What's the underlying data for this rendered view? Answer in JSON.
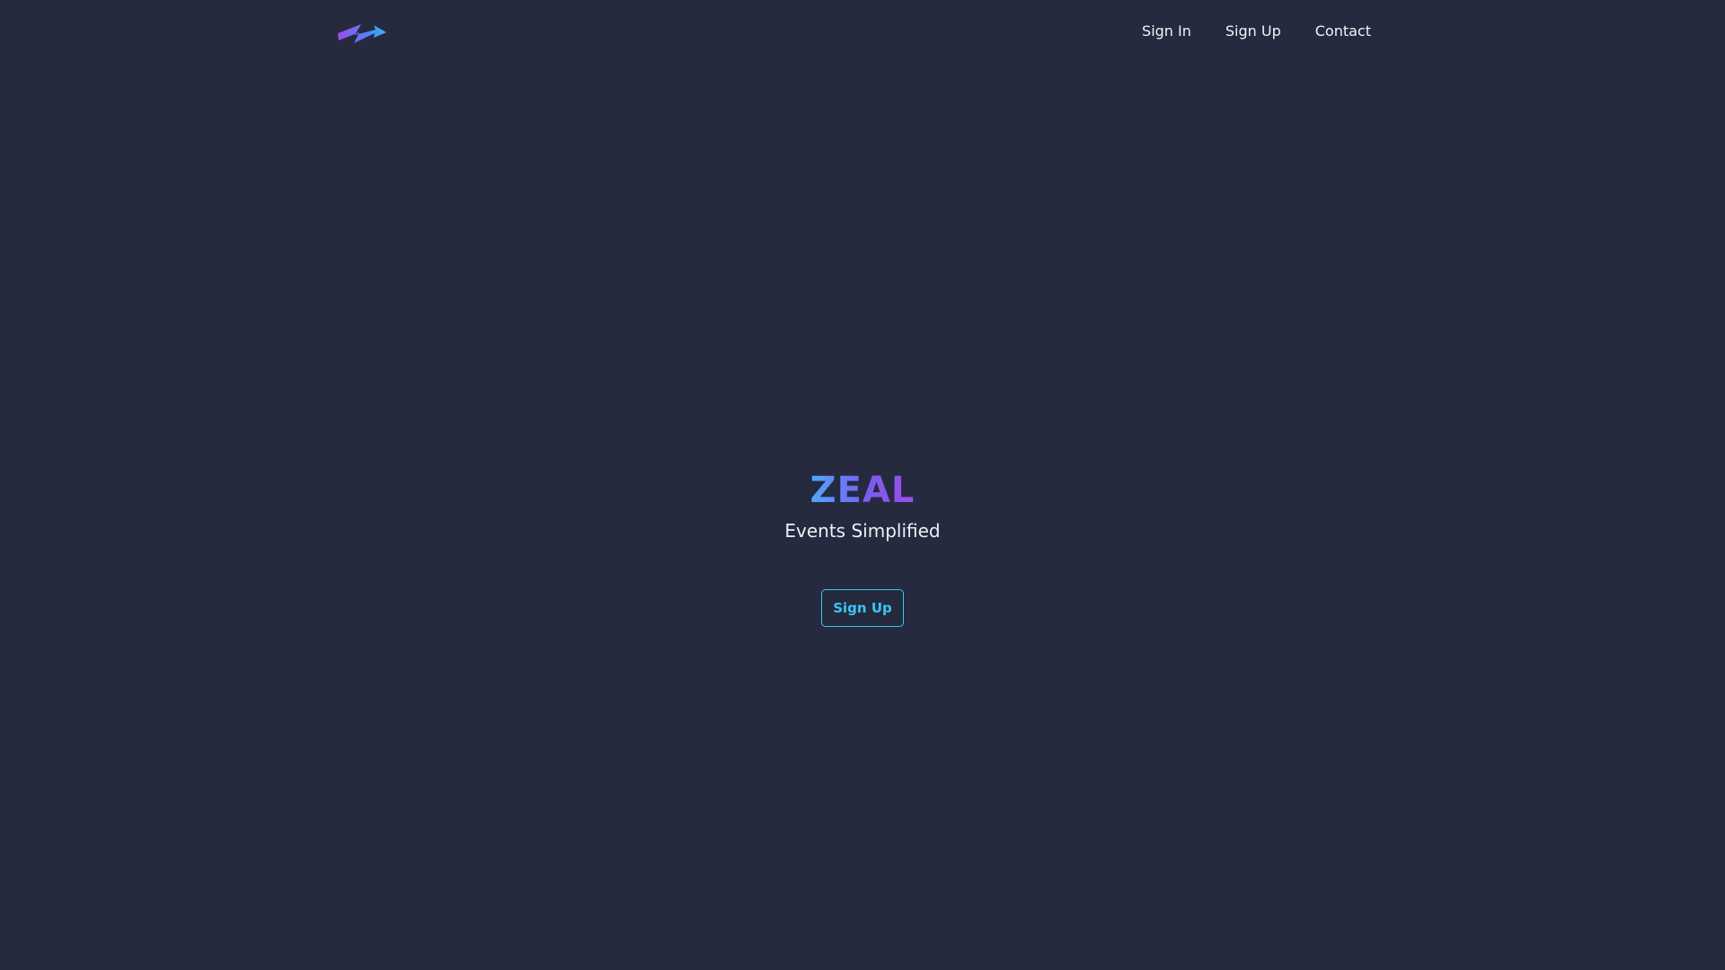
{
  "nav": {
    "logo_icon": "zigzag-arrow-logo-icon",
    "links": [
      "Sign In",
      "Sign Up",
      "Contact"
    ]
  },
  "hero": {
    "brand": "ZEAL",
    "tagline": "Events Simplified",
    "cta_label": "Sign Up"
  },
  "colors": {
    "background": "#252a3f",
    "accent": "#38c6f4",
    "brand_gradient_start": "#4ea8ff",
    "brand_gradient_end": "#9b4de6",
    "text": "#f2f3f7"
  }
}
